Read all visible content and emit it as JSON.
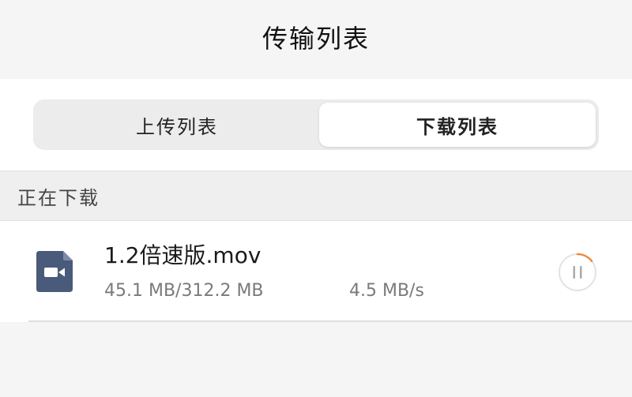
{
  "header": {
    "title": "传输列表"
  },
  "tabs": {
    "upload_label": "上传列表",
    "download_label": "下载列表",
    "selected": "下载列表"
  },
  "section": {
    "title": "正在下载"
  },
  "downloads": [
    {
      "file_name": "1.2倍速版.mov",
      "size_progress": "45.1 MB/312.2 MB",
      "speed": "4.5 MB/s",
      "icon": "video-file-icon",
      "progress_fraction": 0.144,
      "action_icon": "pause-icon"
    }
  ],
  "colors": {
    "accent_progress": "#f08a3c",
    "file_icon_bg": "#4a5a7a",
    "background": "#f5f5f5"
  }
}
